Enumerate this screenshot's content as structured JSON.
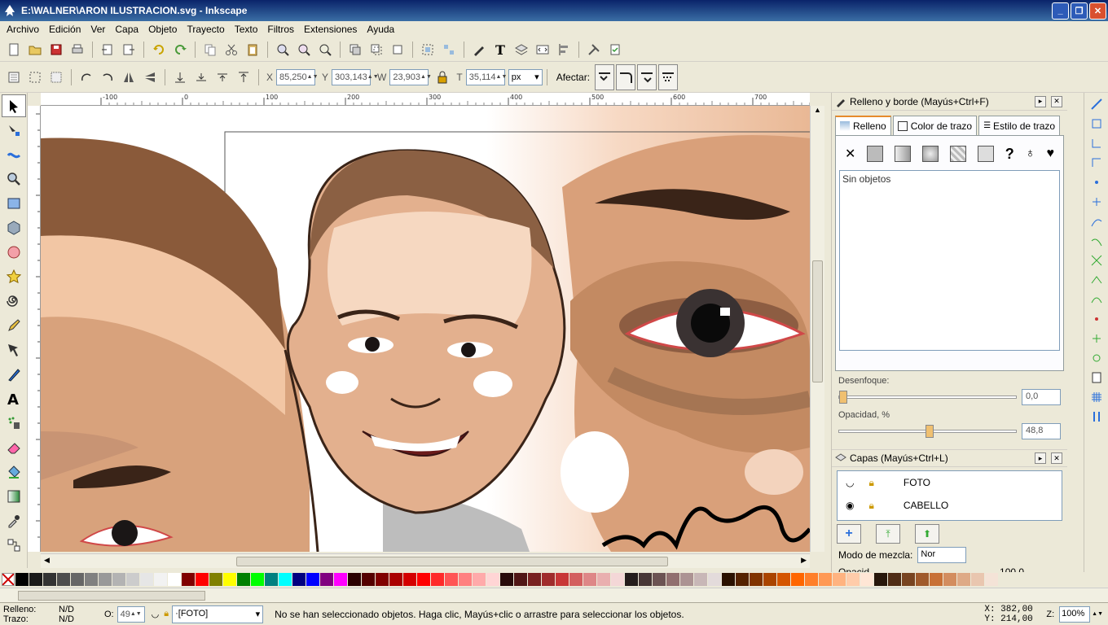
{
  "window": {
    "title": "E:\\WALNER\\ARON ILUSTRACION.svg - Inkscape"
  },
  "menu": [
    "Archivo",
    "Edición",
    "Ver",
    "Capa",
    "Objeto",
    "Trayecto",
    "Texto",
    "Filtros",
    "Extensiones",
    "Ayuda"
  ],
  "select_toolbar": {
    "x_label": "X",
    "x_value": "85,250",
    "y_label": "Y",
    "y_value": "303,143",
    "w_label": "W",
    "w_value": "23,903",
    "h_label": "T",
    "h_value": "35,114",
    "unit": "px",
    "affect_label": "Afectar:"
  },
  "fill_panel": {
    "title": "Relleno y borde (Mayús+Ctrl+F)",
    "tabs": [
      "Relleno",
      "Color de trazo",
      "Estilo de trazo"
    ],
    "empty_text": "Sin objetos",
    "blur_label": "Desenfoque:",
    "blur_value": "0,0",
    "opacity_label": "Opacidad, %",
    "opacity_value": "48,8"
  },
  "layers_panel": {
    "title": "Capas (Mayús+Ctrl+L)",
    "layers": [
      "FOTO",
      "CABELLO"
    ],
    "blend_label": "Modo de mezcla:",
    "blend_value": "Nor",
    "opacity_partial": "Opacid",
    "opacity_value": "100,0"
  },
  "ruler": {
    "h_ticks": [
      "-100",
      "0",
      "100",
      "200",
      "300",
      "400",
      "500",
      "600",
      "700"
    ]
  },
  "status": {
    "fill_label": "Relleno:",
    "fill_value": "N/D",
    "stroke_label": "Trazo:",
    "stroke_value": "N/D",
    "o_label": "O:",
    "o_value": "49",
    "current_layer": "·[FOTO]",
    "message": "No se han seleccionado objetos. Haga clic, Mayús+clic o arrastre para seleccionar los objetos.",
    "x_label": "X:",
    "x_value": "382,00",
    "y_label": "Y:",
    "y_value": "214,00",
    "z_label": "Z:",
    "zoom": "100%"
  },
  "palette": [
    "#000000",
    "#1a1a1a",
    "#333333",
    "#4d4d4d",
    "#666666",
    "#808080",
    "#999999",
    "#b3b3b3",
    "#cccccc",
    "#e6e6e6",
    "#f2f2f2",
    "#ffffff",
    "#800000",
    "#ff0000",
    "#808000",
    "#ffff00",
    "#008000",
    "#00ff00",
    "#008080",
    "#00ffff",
    "#000080",
    "#0000ff",
    "#800080",
    "#ff00ff",
    "#2b0000",
    "#550000",
    "#800000",
    "#aa0000",
    "#d40000",
    "#ff0000",
    "#ff2a2a",
    "#ff5555",
    "#ff8080",
    "#ffaaaa",
    "#ffd5d5",
    "#280b0b",
    "#501616",
    "#782121",
    "#a02c2c",
    "#c83737",
    "#d35f5f",
    "#de8787",
    "#e9afaf",
    "#f4d7d7",
    "#241c1c",
    "#483737",
    "#6c5353",
    "#916f6f",
    "#ac9393",
    "#c8b7b7",
    "#e3dbdb",
    "#2b1100",
    "#552200",
    "#803300",
    "#aa4400",
    "#d45500",
    "#ff6600",
    "#ff7f2a",
    "#ff9955",
    "#ffb380",
    "#ffccaa",
    "#ffe6d5",
    "#28170b",
    "#502d16",
    "#784421",
    "#a05a2c",
    "#c87137",
    "#d38d5f",
    "#deaa87",
    "#e9c6af",
    "#f4e3d7"
  ]
}
